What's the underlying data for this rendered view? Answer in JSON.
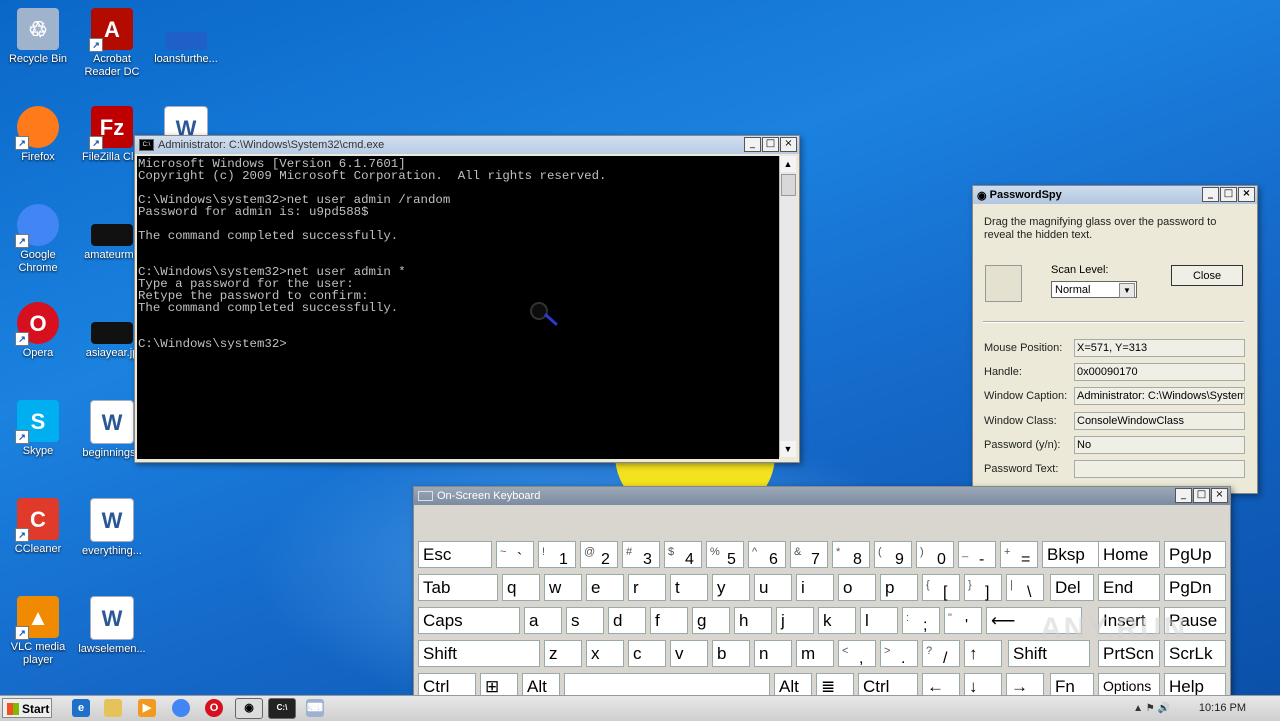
{
  "desktop": {
    "icons": [
      {
        "label": "Recycle Bin",
        "icon": "recycle-bin-icon",
        "color": "#9fb4cc",
        "glyph": "♲",
        "shortcut": false
      },
      {
        "label": "Acrobat Reader DC",
        "icon": "acrobat-icon",
        "color": "#b30b00",
        "glyph": "A",
        "shortcut": true
      },
      {
        "label": "loansfurthe...",
        "icon": "document-icon",
        "color": "#1e5fc8",
        "glyph": "",
        "shortcut": false
      },
      {
        "label": "Firefox",
        "icon": "firefox-icon",
        "color": "#ff7a1a",
        "glyph": "",
        "shortcut": true
      },
      {
        "label": "FileZilla Clie",
        "icon": "filezilla-icon",
        "color": "#bf0000",
        "glyph": "Fz",
        "shortcut": true
      },
      {
        "label": "",
        "icon": "word-document-icon",
        "color": "#2b5797",
        "glyph": "W",
        "shortcut": false
      },
      {
        "label": "Google Chrome",
        "icon": "chrome-icon",
        "color": "#4285f4",
        "glyph": "",
        "shortcut": true
      },
      {
        "label": "amateurmo",
        "icon": "file-thumbnail-icon",
        "color": "#111111",
        "glyph": "",
        "shortcut": false
      },
      {
        "label": "Opera",
        "icon": "opera-icon",
        "color": "#d6101f",
        "glyph": "O",
        "shortcut": true
      },
      {
        "label": "asiayear.jp",
        "icon": "image-file-icon",
        "color": "#111111",
        "glyph": "",
        "shortcut": false
      },
      {
        "label": "Skype",
        "icon": "skype-icon",
        "color": "#00aff0",
        "glyph": "S",
        "shortcut": true
      },
      {
        "label": "beginningse",
        "icon": "word-document-icon",
        "color": "#2b5797",
        "glyph": "W",
        "shortcut": false
      },
      {
        "label": "CCleaner",
        "icon": "ccleaner-icon",
        "color": "#e03a2a",
        "glyph": "C",
        "shortcut": true
      },
      {
        "label": "everything...",
        "icon": "word-document-icon",
        "color": "#2b5797",
        "glyph": "W",
        "shortcut": false
      },
      {
        "label": "VLC media player",
        "icon": "vlc-icon",
        "color": "#f08a00",
        "glyph": "▲",
        "shortcut": true
      },
      {
        "label": "lawselemen...",
        "icon": "word-document-icon",
        "color": "#2b5797",
        "glyph": "W",
        "shortcut": false
      }
    ]
  },
  "cmd": {
    "title": "Administrator: C:\\Windows\\System32\\cmd.exe",
    "lines": [
      "Microsoft Windows [Version 6.1.7601]",
      "Copyright (c) 2009 Microsoft Corporation.  All rights reserved.",
      "",
      "C:\\Windows\\system32>net user admin /random",
      "Password for admin is: u9pd588$",
      "",
      "The command completed successfully.",
      "",
      "",
      "C:\\Windows\\system32>net user admin *",
      "Type a password for the user:",
      "Retype the password to confirm:",
      "The command completed successfully.",
      "",
      "",
      "C:\\Windows\\system32>"
    ]
  },
  "passwordspy": {
    "title": "PasswordSpy",
    "description": "Drag the magnifying glass over the password to reveal the hidden text.",
    "scan_label": "Scan Level:",
    "scan_value": "Normal",
    "close_label": "Close",
    "fields": [
      {
        "key": "Mouse Position:",
        "value": "X=571, Y=313"
      },
      {
        "key": "Handle:",
        "value": "0x00090170"
      },
      {
        "key": "Window Caption:",
        "value": "Administrator: C:\\Windows\\System32"
      },
      {
        "key": "Window Class:",
        "value": "ConsoleWindowClass"
      },
      {
        "key": "Password (y/n):",
        "value": "No"
      },
      {
        "key": "Password Text:",
        "value": ""
      }
    ]
  },
  "osk": {
    "title": "On-Screen Keyboard",
    "rows": [
      [
        [
          "Esc"
        ],
        [
          "~",
          "`"
        ],
        [
          "!",
          "1"
        ],
        [
          "@",
          "2"
        ],
        [
          "#",
          "3"
        ],
        [
          "$",
          "4"
        ],
        [
          "%",
          "5"
        ],
        [
          "^",
          "6"
        ],
        [
          "&",
          "7"
        ],
        [
          "*",
          "8"
        ],
        [
          "(",
          "9"
        ],
        [
          ")",
          "0"
        ],
        [
          "_",
          "-"
        ],
        [
          "+",
          "="
        ],
        [
          "Bksp"
        ],
        [
          "Home"
        ],
        [
          "PgUp"
        ]
      ],
      [
        [
          "Tab"
        ],
        [
          "q"
        ],
        [
          "w"
        ],
        [
          "e"
        ],
        [
          "r"
        ],
        [
          "t"
        ],
        [
          "y"
        ],
        [
          "u"
        ],
        [
          "i"
        ],
        [
          "o"
        ],
        [
          "p"
        ],
        [
          "{",
          "["
        ],
        [
          "}",
          "]"
        ],
        [
          "|",
          "\\"
        ],
        [
          "Del"
        ],
        [
          "End"
        ],
        [
          "PgDn"
        ]
      ],
      [
        [
          "Caps"
        ],
        [
          "a"
        ],
        [
          "s"
        ],
        [
          "d"
        ],
        [
          "f"
        ],
        [
          "g"
        ],
        [
          "h"
        ],
        [
          "j"
        ],
        [
          "k"
        ],
        [
          "l"
        ],
        [
          ":",
          ";"
        ],
        [
          "\"",
          "'"
        ],
        [
          "⟵"
        ],
        [
          "Insert"
        ],
        [
          "Pause"
        ]
      ],
      [
        [
          "Shift"
        ],
        [
          "z"
        ],
        [
          "x"
        ],
        [
          "c"
        ],
        [
          "v"
        ],
        [
          "b"
        ],
        [
          "n"
        ],
        [
          "m"
        ],
        [
          "<",
          ","
        ],
        [
          ">",
          "."
        ],
        [
          "?",
          "/"
        ],
        [
          "↑"
        ],
        [
          "Shift"
        ],
        [
          "PrtScn"
        ],
        [
          "ScrLk"
        ]
      ],
      [
        [
          "Ctrl"
        ],
        [
          "⊞"
        ],
        [
          "Alt"
        ],
        [
          " "
        ],
        [
          "Alt"
        ],
        [
          "≣"
        ],
        [
          "Ctrl"
        ],
        [
          "←"
        ],
        [
          "↓"
        ],
        [
          "→"
        ],
        [
          "Fn"
        ],
        [
          "Options"
        ],
        [
          "Help"
        ]
      ]
    ]
  },
  "watermark": "ANY.RUN",
  "taskbar": {
    "start_label": "Start",
    "clock": "10:16 PM"
  }
}
